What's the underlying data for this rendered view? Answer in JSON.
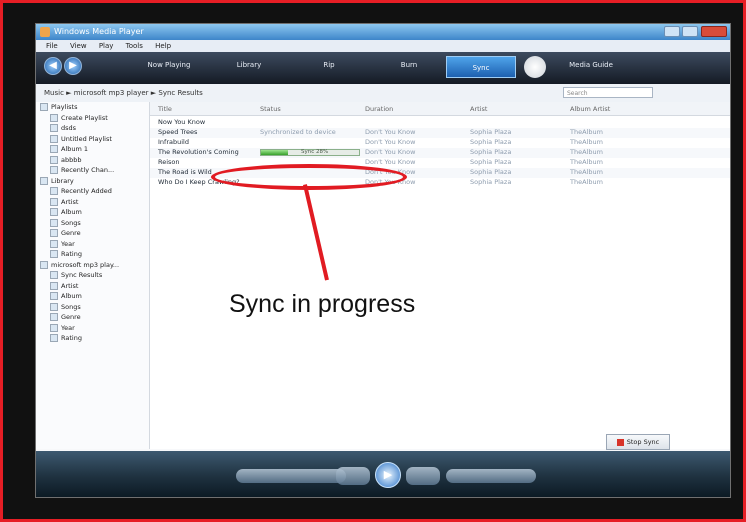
{
  "window": {
    "title": "Windows Media Player"
  },
  "menu": [
    "File",
    "View",
    "Play",
    "Tools",
    "Help"
  ],
  "nav": {
    "tabs": [
      {
        "label": "Now Playing",
        "active": false
      },
      {
        "label": "Library",
        "active": false
      },
      {
        "label": "Rip",
        "active": false
      },
      {
        "label": "Burn",
        "active": false
      },
      {
        "label": "Sync",
        "active": true
      },
      {
        "label": "Media Guide",
        "active": false
      }
    ]
  },
  "pathbar": {
    "breadcrumb": "Music ► microsoft mp3 player ► Sync Results",
    "search_placeholder": "Search"
  },
  "tree": [
    {
      "label": "Playlists",
      "level": 0
    },
    {
      "label": "Create Playlist",
      "level": 1
    },
    {
      "label": "dsds",
      "level": 1
    },
    {
      "label": "Untitled Playlist",
      "level": 1
    },
    {
      "label": "Album 1",
      "level": 1
    },
    {
      "label": "abbbb",
      "level": 1
    },
    {
      "label": "Recently Chan...",
      "level": 1
    },
    {
      "label": "Library",
      "level": 0
    },
    {
      "label": "Recently Added",
      "level": 1
    },
    {
      "label": "Artist",
      "level": 1
    },
    {
      "label": "Album",
      "level": 1
    },
    {
      "label": "Songs",
      "level": 1
    },
    {
      "label": "Genre",
      "level": 1
    },
    {
      "label": "Year",
      "level": 1
    },
    {
      "label": "Rating",
      "level": 1
    },
    {
      "label": "microsoft mp3 play...",
      "level": 0
    },
    {
      "label": "Sync Results",
      "level": 1
    },
    {
      "label": "Artist",
      "level": 1
    },
    {
      "label": "Album",
      "level": 1
    },
    {
      "label": "Songs",
      "level": 1
    },
    {
      "label": "Genre",
      "level": 1
    },
    {
      "label": "Year",
      "level": 1
    },
    {
      "label": "Rating",
      "level": 1
    }
  ],
  "columns": [
    "Title",
    "Status",
    "Duration",
    "Artist",
    "Album Artist"
  ],
  "rows": [
    {
      "title": "Now You Know",
      "status": "",
      "c3": "",
      "c4": "",
      "c5": ""
    },
    {
      "title": "Speed Trees",
      "status": "Synchronized to device",
      "c3": "Don't You Know",
      "c4": "Sophia Plaza",
      "c5": "TheAlbum"
    },
    {
      "title": "Infrabuild",
      "status": "",
      "c3": "Don't You Know",
      "c4": "Sophia Plaza",
      "c5": "TheAlbum"
    },
    {
      "title": "The Revolution's Coming",
      "status": "Sync 28%",
      "progress": 0.28,
      "c3": "Don't You Know",
      "c4": "Sophia Plaza",
      "c5": "TheAlbum"
    },
    {
      "title": "Reison",
      "status": "",
      "c3": "Don't You Know",
      "c4": "Sophia Plaza",
      "c5": "TheAlbum"
    },
    {
      "title": "The Road is Wild",
      "status": "",
      "c3": "Don't You Know",
      "c4": "Sophia Plaza",
      "c5": "TheAlbum"
    },
    {
      "title": "Who Do I Keep Crawling?",
      "status": "",
      "c3": "Don't You Know",
      "c4": "Sophia Plaza",
      "c5": "TheAlbum"
    }
  ],
  "stop_sync_label": "Stop Sync",
  "callout": {
    "text": "Sync in progress"
  }
}
